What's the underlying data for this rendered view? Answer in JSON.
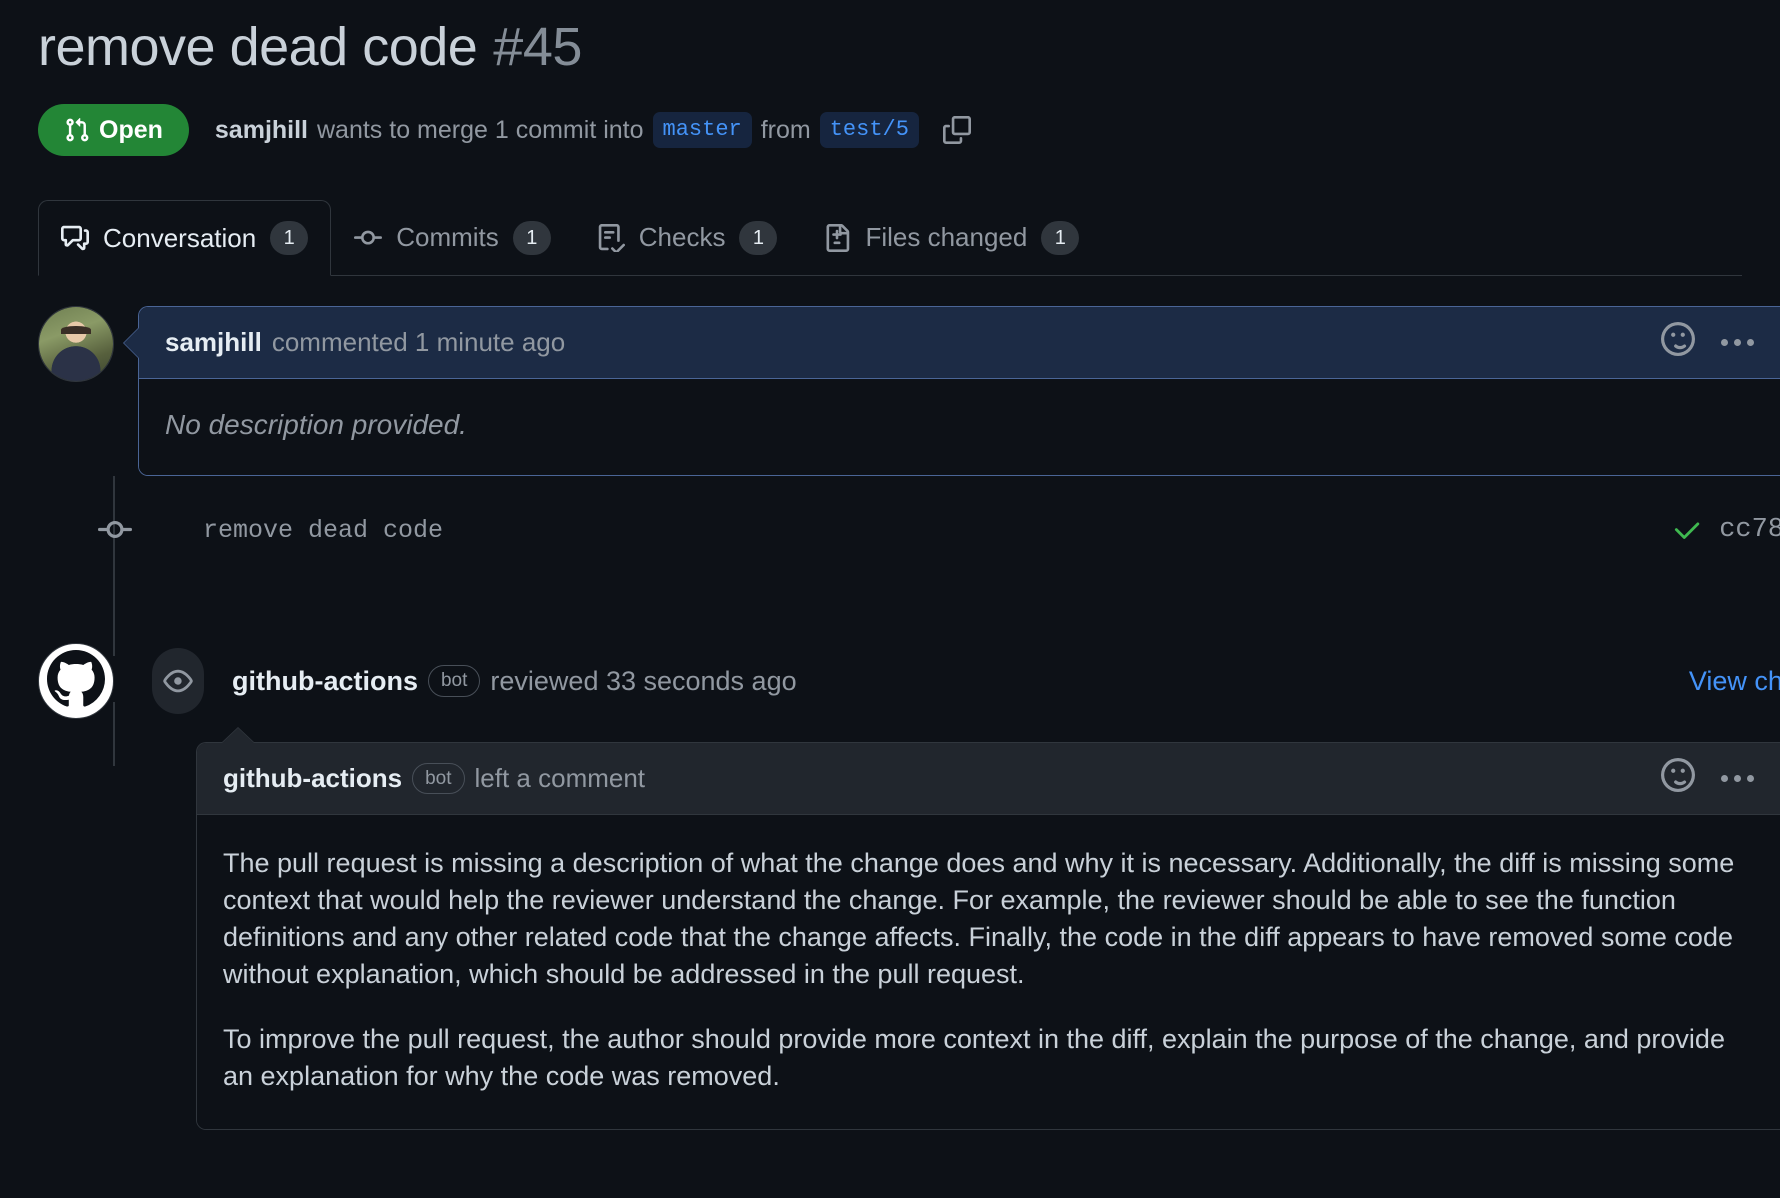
{
  "header": {
    "title": "remove dead code",
    "number": "#45",
    "state": "Open",
    "author": "samjhill",
    "merge_text_1": "wants to merge 1 commit into",
    "base_branch": "master",
    "merge_text_2": "from",
    "head_branch": "test/5",
    "copy_icon": "copy-icon"
  },
  "tabs": [
    {
      "label": "Conversation",
      "count": "1",
      "icon": "comment-discussion-icon",
      "selected": true
    },
    {
      "label": "Commits",
      "count": "1",
      "icon": "git-commit-icon",
      "selected": false
    },
    {
      "label": "Checks",
      "count": "1",
      "icon": "checklist-icon",
      "selected": false
    },
    {
      "label": "Files changed",
      "count": "1",
      "icon": "file-diff-icon",
      "selected": false
    }
  ],
  "first_comment": {
    "author": "samjhill",
    "action": "commented 1 minute ago",
    "body": "No description provided.",
    "reaction_icon": "smiley-icon",
    "menu_icon": "kebab-horizontal-icon"
  },
  "commit": {
    "message": "remove dead code",
    "status_icon": "check-icon",
    "sha": "cc78"
  },
  "review": {
    "author": "github-actions",
    "bot_tag": "bot",
    "action": "reviewed 33 seconds ago",
    "view_changes_label": "View chang",
    "eye_icon": "eye-icon"
  },
  "review_comment": {
    "author": "github-actions",
    "bot_tag": "bot",
    "action": "left a comment",
    "reaction_icon": "smiley-icon",
    "menu_icon": "kebab-horizontal-icon",
    "paragraphs": [
      "The pull request is missing a description of what the change does and why it is necessary. Additionally, the diff is missing some context that would help the reviewer understand the change. For example, the reviewer should be able to see the function definitions and any other related code that the change affects. Finally, the code in the diff appears to have removed some code without explanation, which should be addressed in the pull request.",
      "To improve the pull request, the author should provide more context in the diff, explain the purpose of the change, and provide an explanation for why the code was removed."
    ]
  },
  "colors": {
    "background": "#0d1117",
    "open_green": "#238636",
    "link_blue": "#4493f8",
    "border": "#30363d",
    "highlight_border": "#4a6596",
    "highlight_bg": "#1c2b45",
    "check_green": "#3fb950"
  }
}
